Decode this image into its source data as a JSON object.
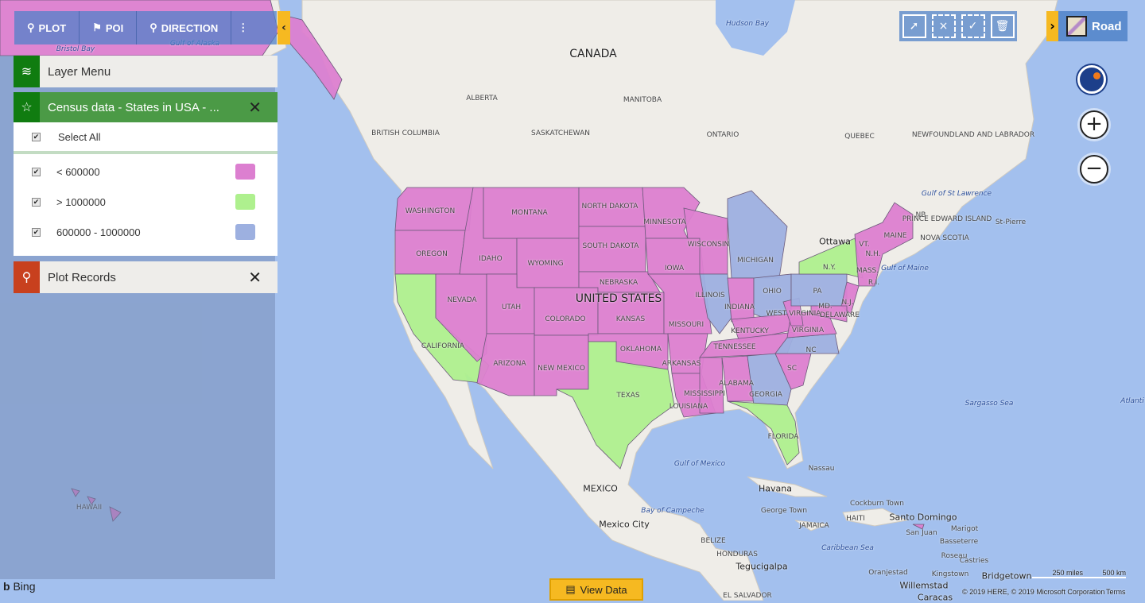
{
  "toolbar": {
    "plot": "PLOT",
    "poi": "POI",
    "direction": "DIRECTION",
    "more_icon": "vertical-dots",
    "collapse_icon": "chevron-left"
  },
  "panel": {
    "layer_menu": "Layer Menu",
    "census_title": "Census data - States in USA - ...",
    "select_all": "Select All",
    "legend": [
      {
        "label": "< 600000",
        "color": "#dc7fd0",
        "checked": true
      },
      {
        "label": "> 1000000",
        "color": "#aef08e",
        "checked": true
      },
      {
        "label": "600000 - 1000000",
        "color": "#9db0e0",
        "checked": true
      }
    ],
    "plot_records": "Plot Records"
  },
  "tools": [
    "select-pointer-icon",
    "clear-selection-icon",
    "select-area-icon",
    "trash-icon"
  ],
  "map_style": {
    "label": "Road"
  },
  "controls": {
    "zoom_in": "+",
    "zoom_out": "−"
  },
  "view_data": "View Data",
  "map_labels": {
    "canada": "CANADA",
    "us": "UNITED STATES",
    "mexico": "MEXICO",
    "alberta": "ALBERTA",
    "manitoba": "MANITOBA",
    "bc": "BRITISH COLUMBIA",
    "sask": "SASKATCHEWAN",
    "ontario": "ONTARIO",
    "quebec": "QUEBEC",
    "nfl": "NEWFOUNDLAND AND LABRADOR",
    "hudson": "Hudson Bay",
    "gulf_alaska": "Gulf of Alaska",
    "bristol": "Bristol Bay",
    "gulf_st": "Gulf of St Lawrence",
    "gulf_maine": "Gulf of Maine",
    "sargasso": "Sargasso Sea",
    "atlantic": "Atlanti",
    "gulf_mexico": "Gulf of Mexico",
    "campeche": "Bay of Campeche",
    "caribbean": "Caribbean Sea",
    "washington": "WASHINGTON",
    "oregon": "OREGON",
    "california": "CALIFORNIA",
    "nevada": "NEVADA",
    "idaho": "IDAHO",
    "montana": "MONTANA",
    "wyoming": "WYOMING",
    "utah": "UTAH",
    "colorado": "COLORADO",
    "arizona": "ARIZONA",
    "new_mexico": "NEW MEXICO",
    "north_dakota": "NORTH DAKOTA",
    "south_dakota": "SOUTH DAKOTA",
    "nebraska": "NEBRASKA",
    "kansas": "KANSAS",
    "oklahoma": "OKLAHOMA",
    "texas": "TEXAS",
    "minnesota": "MINNESOTA",
    "iowa": "IOWA",
    "missouri": "MISSOURI",
    "arkansas": "ARKANSAS",
    "louisiana": "LOUISIANA",
    "wisconsin": "WISCONSIN",
    "illinois": "ILLINOIS",
    "michigan": "MICHIGAN",
    "indiana": "INDIANA",
    "ohio": "OHIO",
    "kentucky": "KENTUCKY",
    "tennessee": "TENNESSEE",
    "mississippi": "MISSISSIPPI",
    "alabama": "ALABAMA",
    "georgia": "GEORGIA",
    "florida": "FLORIDA",
    "sc": "SC",
    "nc": "NC",
    "virginia": "VIRGINIA",
    "wv": "WEST VIRGINIA",
    "pa": "PA",
    "ny": "N.Y.",
    "nj": "N.J.",
    "md": "MD.",
    "delaware": "DELAWARE",
    "maine": "MAINE",
    "vt": "VT.",
    "nh": "N.H.",
    "mass": "MASS.",
    "ri": "R.I.",
    "hawaii": "HAWAII",
    "nb": "NB",
    "pei": "PRINCE EDWARD ISLAND",
    "ns": "NOVA SCOTIA",
    "ottawa": "Ottawa",
    "st_pierre": "St-Pierre",
    "nassau": "Nassau",
    "havana": "Havana",
    "georgetown": "George Town",
    "jamaica": "JAMAICA",
    "haiti": "HAITI",
    "cockburn": "Cockburn Town",
    "santo_domingo": "Santo Domingo",
    "san_juan": "San Juan",
    "basseterre": "Basseterre",
    "marigot": "Marigot",
    "roseau": "Roseau",
    "castries": "Castries",
    "kingstown": "Kingstown",
    "bridgetown": "Bridgetown",
    "oranjestad": "Oranjestad",
    "willemstad": "Willemstad",
    "caracas": "Caracas",
    "mexico_city": "Mexico City",
    "belize": "BELIZE",
    "honduras": "HONDURAS",
    "tegucigalpa": "Tegucigalpa",
    "el_salvador": "EL SALVADOR"
  },
  "scale": {
    "miles": "250 miles",
    "km": "500 km"
  },
  "attribution": "© 2019 HERE, © 2019 Microsoft Corporation",
  "terms": "Terms",
  "brand": "Bing"
}
